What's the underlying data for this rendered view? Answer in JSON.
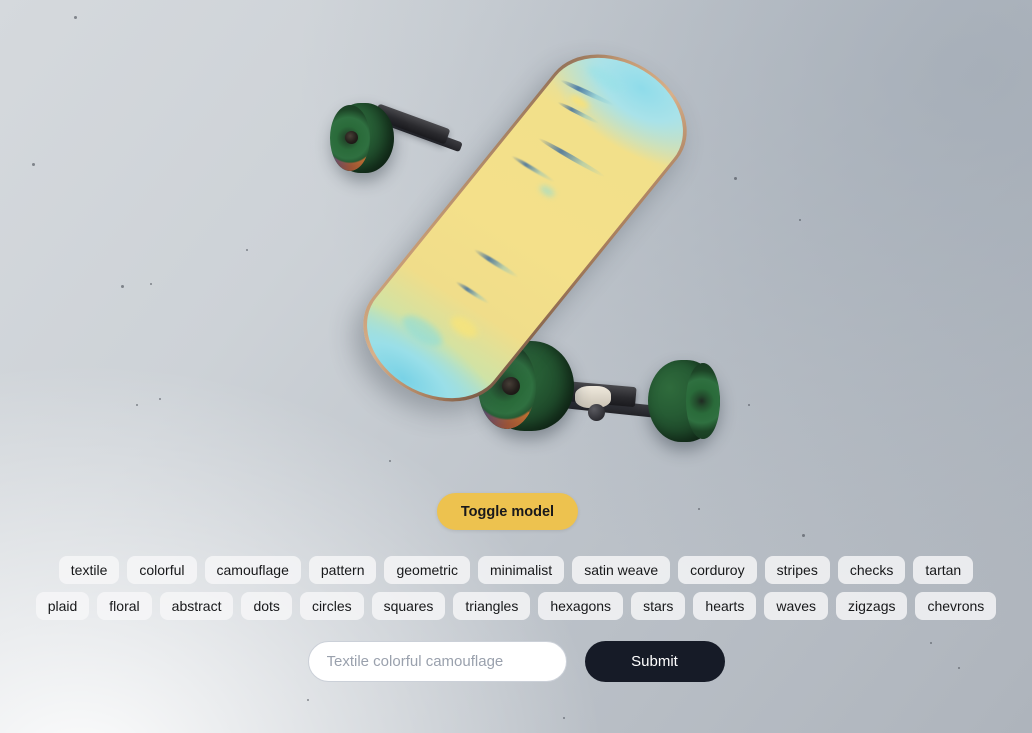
{
  "viewport": {
    "model_name": "skateboard-3d-model",
    "deck_colors": {
      "primary": "#f2e08a",
      "secondary": "#8fdcea",
      "edge": "#c49a74"
    },
    "wheel_color": "#265c34",
    "truck_color": "#2a2a2e",
    "background": {
      "light": "#f2f3f4",
      "mid": "#cdd2d7",
      "dark": "#aeb4bc"
    }
  },
  "toggle": {
    "label": "Toggle model",
    "color": "#edc24f",
    "text_color": "#18181b"
  },
  "tags": {
    "row1": [
      "textile",
      "colorful",
      "camouflage",
      "pattern",
      "geometric",
      "minimalist",
      "satin weave",
      "corduroy",
      "stripes",
      "checks",
      "tartan"
    ],
    "row2": [
      "plaid",
      "floral",
      "abstract",
      "dots",
      "circles",
      "squares",
      "triangles",
      "hexagons",
      "stars",
      "hearts",
      "waves",
      "zigzags",
      "chevrons"
    ]
  },
  "prompt": {
    "value": "",
    "placeholder": "Textile colorful camouflage",
    "submit_label": "Submit",
    "submit_color": "#161b27"
  }
}
